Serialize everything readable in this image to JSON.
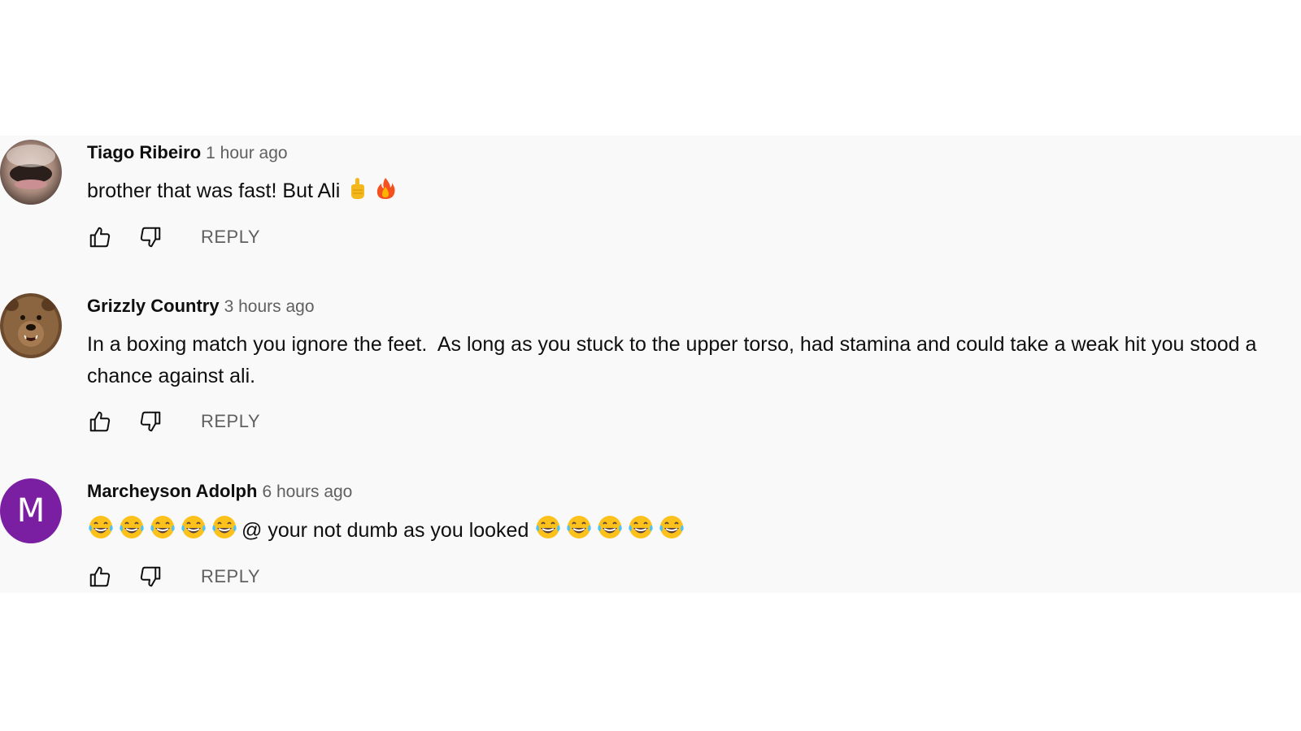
{
  "comments": [
    {
      "author": "Tiago Ribeiro",
      "timestamp": "1 hour ago",
      "text": "brother that was fast! But Ali",
      "emojis": [
        "point-up-emoji",
        "fire-emoji"
      ],
      "avatar": "photo-avatar",
      "reply_label": "REPLY"
    },
    {
      "author": "Grizzly Country",
      "timestamp": "3 hours ago",
      "text": "In a boxing match you ignore the feet.  As long as you stuck to the upper torso, had stamina and could take a weak hit you stood a chance against ali.",
      "avatar": "bear-photo-avatar",
      "reply_label": "REPLY"
    },
    {
      "author": "Marcheyson Adolph",
      "timestamp": "6 hours ago",
      "text": "@ your not dumb as you looked",
      "emojis_before": [
        "laughing-emoji",
        "laughing-emoji",
        "laughing-emoji",
        "laughing-emoji",
        "laughing-emoji"
      ],
      "emojis_after": [
        "laughing-emoji",
        "laughing-emoji",
        "laughing-emoji",
        "laughing-emoji",
        "laughing-emoji"
      ],
      "avatar_letter": "M",
      "avatar_color": "#7b1fa2",
      "reply_label": "REPLY"
    }
  ],
  "colors": {
    "panel_background": "#f9f9f9",
    "author": "#0f0f0f",
    "meta": "#606060"
  }
}
